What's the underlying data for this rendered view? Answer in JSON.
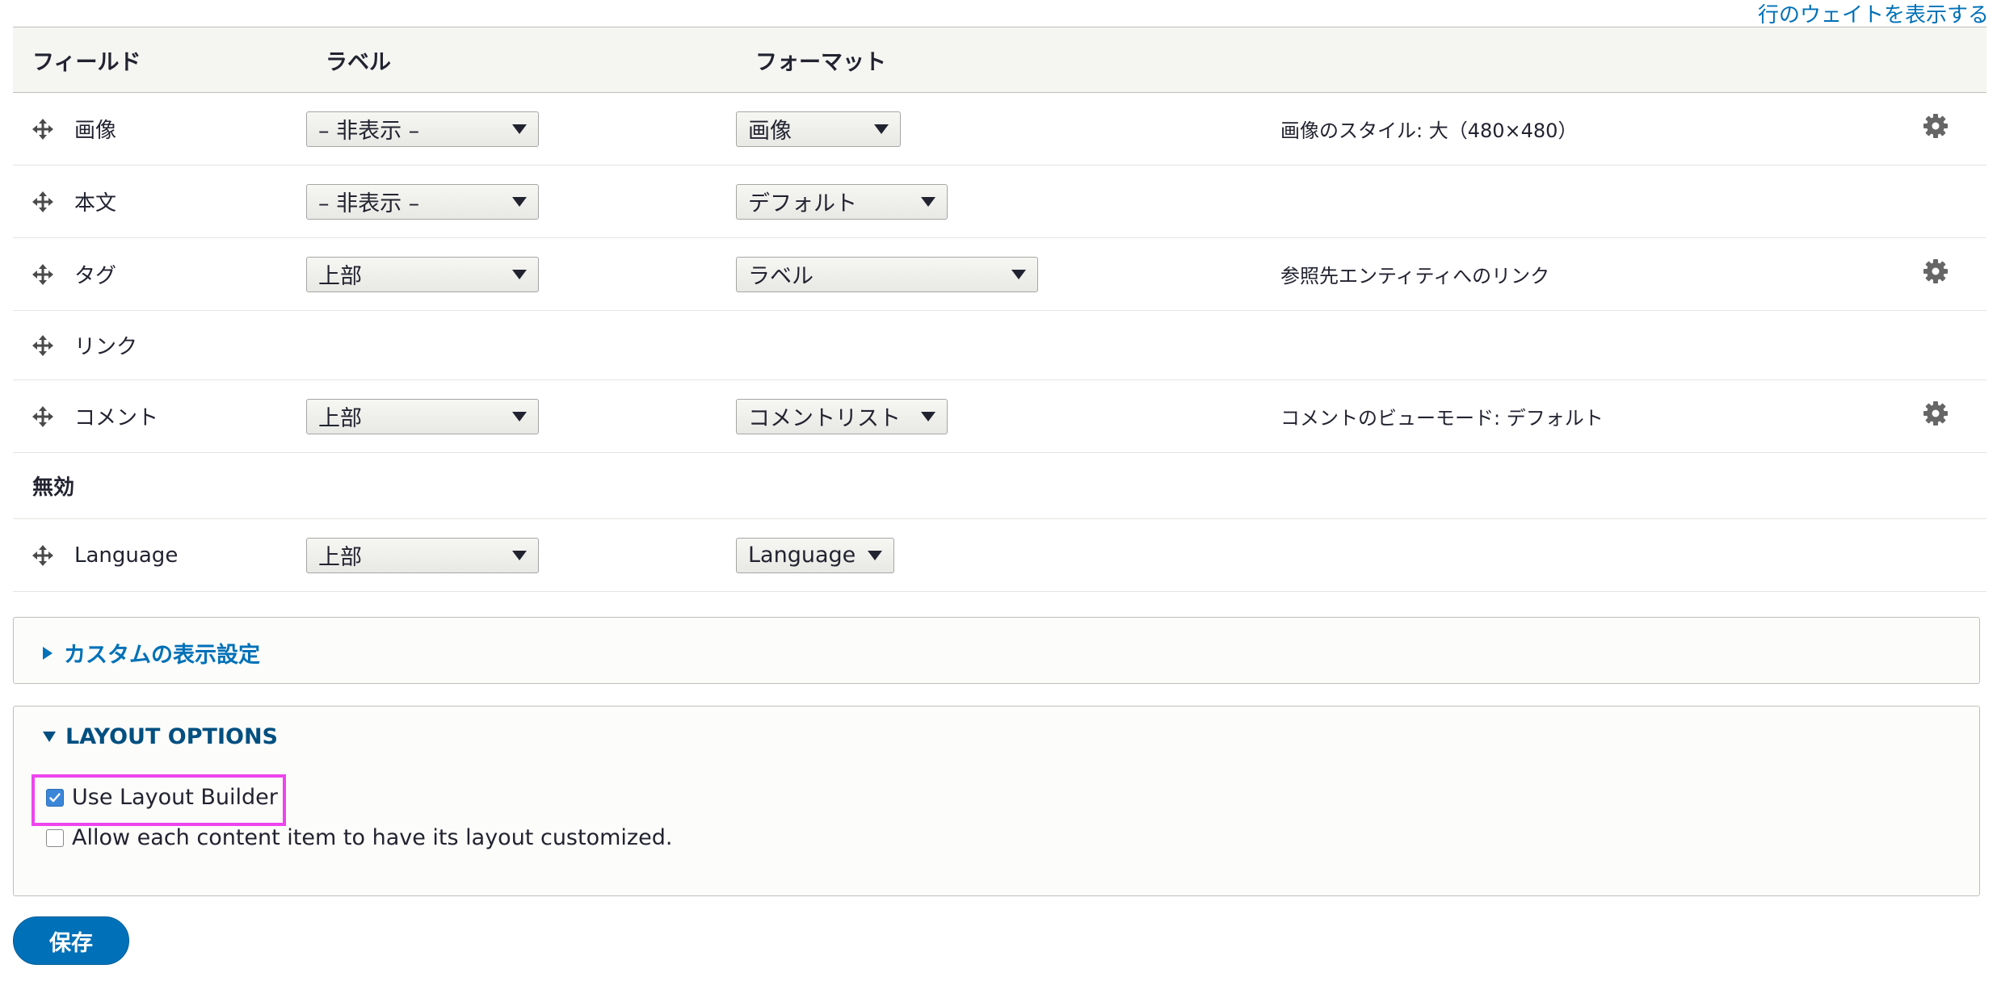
{
  "header_link": "行のウェイトを表示する",
  "table": {
    "columns": [
      "フィールド",
      "ラベル",
      "フォーマット"
    ],
    "rows": [
      {
        "name": "画像",
        "label": "– 非表示 –",
        "format": "画像",
        "summary": "画像のスタイル: 大（480×480）",
        "settings": true
      },
      {
        "name": "本文",
        "label": "– 非表示 –",
        "format": "デフォルト",
        "summary": "",
        "settings": false
      },
      {
        "name": "タグ",
        "label": "上部",
        "format": "ラベル",
        "summary": "参照先エンティティへのリンク",
        "settings": true
      },
      {
        "name": "リンク",
        "label": "",
        "format": "",
        "summary": "",
        "settings": false
      },
      {
        "name": "コメント",
        "label": "上部",
        "format": "コメントリスト",
        "summary": "コメントのビューモード: デフォルト",
        "settings": true
      }
    ],
    "disabled_region": "無効",
    "disabled_rows": [
      {
        "name": "Language",
        "label": "上部",
        "format": "Language"
      }
    ]
  },
  "custom_display": {
    "title": "カスタムの表示設定",
    "expanded": false
  },
  "layout_options": {
    "title": "LAYOUT OPTIONS",
    "expanded": true,
    "use_layout_builder": {
      "label": "Use Layout Builder",
      "checked": true
    },
    "allow_custom": {
      "label": "Allow each content item to have its layout customized.",
      "checked": false
    }
  },
  "save_label": "保存",
  "colors": {
    "link": "#0071b8",
    "highlight": "#ee44ee",
    "primary": "#0071b8"
  },
  "icons": {
    "drag": "drag-handle-icon",
    "settings": "gear-icon",
    "check": "checkmark-icon"
  }
}
